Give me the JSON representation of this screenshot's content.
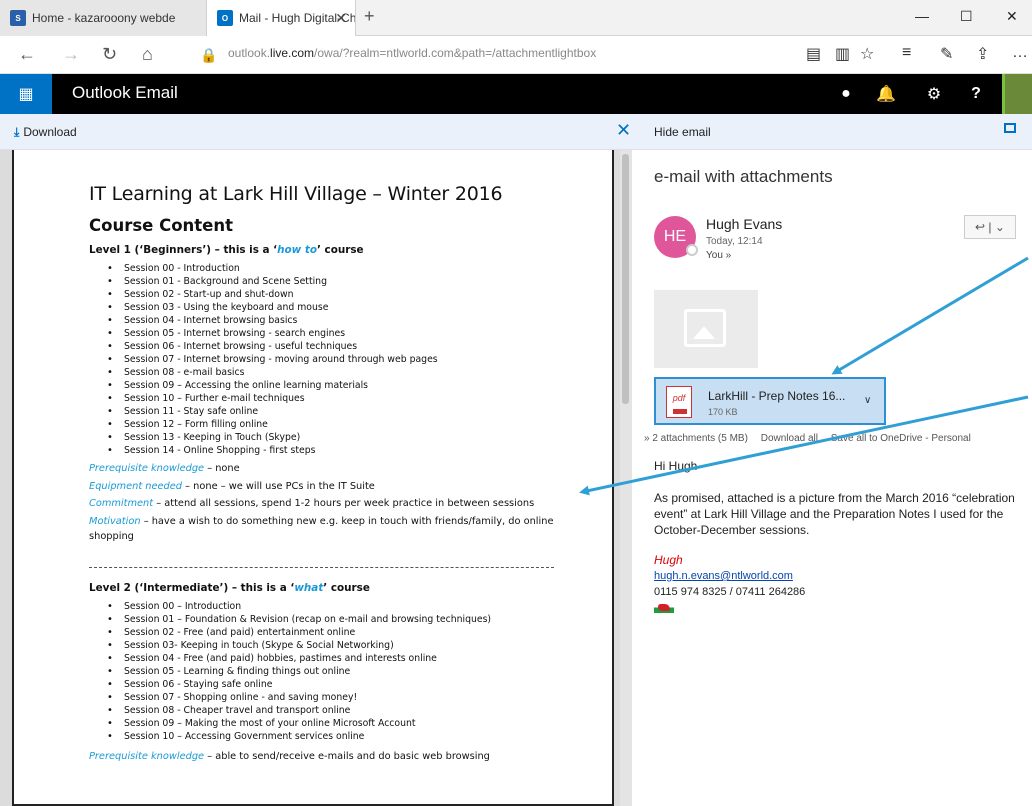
{
  "browser": {
    "tabs": [
      {
        "title": "Home - kazarooony webde",
        "favicon": "S"
      },
      {
        "title": "Mail - Hugh Digital-Cha",
        "favicon": "O"
      }
    ],
    "url_prefix": "outlook.",
    "url_domain": "live.com",
    "url_rest": "/owa/?realm=ntlworld.com&path=/attachmentlightbox"
  },
  "header": {
    "app_title": "Outlook Email"
  },
  "toolbar": {
    "download_label": "Download",
    "hide_email_label": "Hide email"
  },
  "document": {
    "title": "IT Learning at Lark Hill Village – Winter 2016",
    "heading": "Course Content",
    "level1": {
      "prefix": "Level 1 (‘Beginners’) – this is a ‘",
      "emph": "how to",
      "suffix": "’ course",
      "sessions": [
        "Session 00 - Introduction",
        "Session 01 - Background and Scene Setting",
        "Session 02 - Start-up and shut-down",
        "Session 03 - Using the keyboard and mouse",
        "Session 04 - Internet browsing basics",
        "Session 05 - Internet browsing - search engines",
        "Session 06 - Internet browsing - useful techniques",
        "Session 07 - Internet browsing - moving around through web pages",
        "Session 08 - e-mail basics",
        "Session 09 – Accessing the online learning materials",
        "Session 10 – Further e-mail techniques",
        "Session 11 - Stay safe online",
        "Session 12 – Form filling online",
        "Session 13 - Keeping in Touch (Skype)",
        "Session 14 - Online Shopping - first steps"
      ],
      "requirements": [
        {
          "label": "Prerequisite knowledge",
          "text": " – none"
        },
        {
          "label": "Equipment needed",
          "text": " – none – we will use PCs in the IT Suite"
        },
        {
          "label": "Commitment",
          "text": " – attend all sessions, spend 1-2 hours per week practice in between sessions"
        },
        {
          "label": "Motivation",
          "text": " – have a wish to do something new e.g. keep in touch with friends/family, do online shopping"
        }
      ]
    },
    "level2": {
      "prefix": "Level 2 (‘Intermediate’) – this is a ‘",
      "emph": "what",
      "suffix": "’ course",
      "sessions": [
        "Session 00 – Introduction",
        "Session 01 – Foundation & Revision (recap on e-mail and browsing techniques)",
        "Session 02 - Free (and paid) entertainment online",
        "Session 03- Keeping in touch (Skype & Social Networking)",
        "Session 04 - Free (and paid) hobbies, pastimes and interests online",
        "Session 05 - Learning & finding things out online",
        "Session 06 - Staying safe online",
        "Session 07 - Shopping online - and saving money!",
        "Session 08 - Cheaper travel and transport online",
        "Session 09 – Making the most of your online Microsoft Account",
        "Session 10 – Accessing Government services online"
      ],
      "req_label": "Prerequisite knowledge",
      "req_text": " – able to send/receive e-mails and do basic web browsing"
    }
  },
  "email": {
    "subject": "e-mail with attachments",
    "sender_initials": "HE",
    "sender_name": "Hugh Evans",
    "date": "Today, 12:14",
    "to": "You »",
    "attachment_name": "LarkHill - Prep Notes 16...",
    "attachment_size": "170 KB",
    "attachments_summary": "» 2 attachments (5 MB)",
    "download_all": "Download all",
    "save_onedrive": "Save all to OneDrive - Personal",
    "greeting": "Hi Hugh",
    "body": "As promised, attached is a picture from the March 2016 “celebration event” at Lark Hill Village and the Preparation Notes I used for the October-December sessions.",
    "sig_name": "Hugh",
    "sig_email": "hugh.n.evans@ntlworld.com",
    "sig_phone": "0115 974 8325 / 07411 264286"
  },
  "colors": {
    "accent": "#0072c6",
    "doc_blue": "#1a9ad6",
    "avatar_pink": "#e0569a",
    "annotation_arrow": "#2f9fd6"
  }
}
